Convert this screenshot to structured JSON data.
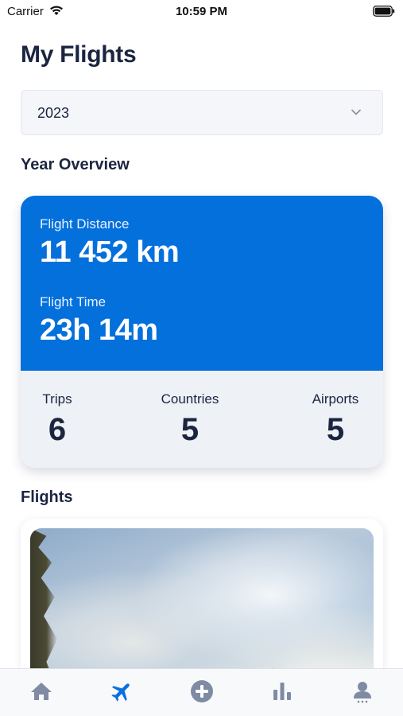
{
  "status_bar": {
    "carrier": "Carrier",
    "time": "10:59 PM"
  },
  "page": {
    "title": "My Flights"
  },
  "year_select": {
    "value": "2023"
  },
  "overview": {
    "section_title": "Year Overview",
    "distance_label": "Flight Distance",
    "distance_value": "11 452 km",
    "time_label": "Flight Time",
    "time_value": "23h 14m",
    "stats": [
      {
        "label": "Trips",
        "value": "6"
      },
      {
        "label": "Countries",
        "value": "5"
      },
      {
        "label": "Airports",
        "value": "5"
      }
    ]
  },
  "flights": {
    "section_title": "Flights"
  },
  "tab_bar": {
    "tabs": [
      {
        "icon": "home-icon",
        "active": false
      },
      {
        "icon": "airplane-icon",
        "active": true
      },
      {
        "icon": "add-circle-icon",
        "active": false
      },
      {
        "icon": "stats-icon",
        "active": false
      },
      {
        "icon": "profile-icon",
        "active": false
      }
    ]
  },
  "colors": {
    "accent": "#0470dc",
    "text_dark": "#1b2540",
    "tab_inactive": "#7f8aa3",
    "tab_active": "#0a6fe0"
  }
}
